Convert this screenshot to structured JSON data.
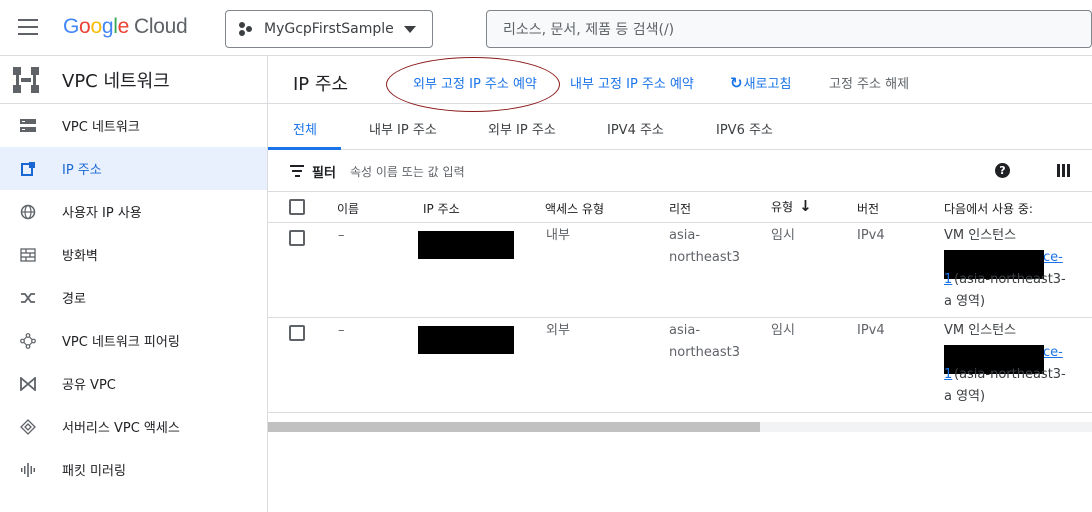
{
  "topbar": {
    "logo": {
      "letters": [
        "G",
        "o",
        "o",
        "g",
        "l",
        "e"
      ],
      "product": "Cloud"
    },
    "project": "MyGcpFirstSample",
    "search_placeholder": "리소스, 문서, 제품 등 검색(/)"
  },
  "sidebar": {
    "title": "VPC 네트워크",
    "items": [
      {
        "label": "VPC 네트워크",
        "icon": "vpc-network-icon",
        "active": false
      },
      {
        "label": "IP 주소",
        "icon": "ip-address-icon",
        "active": true
      },
      {
        "label": "사용자 IP 사용",
        "icon": "globe-icon",
        "active": false
      },
      {
        "label": "방화벽",
        "icon": "firewall-icon",
        "active": false
      },
      {
        "label": "경로",
        "icon": "routes-icon",
        "active": false
      },
      {
        "label": "VPC 네트워크 피어링",
        "icon": "peering-icon",
        "active": false
      },
      {
        "label": "공유 VPC",
        "icon": "shared-vpc-icon",
        "active": false
      },
      {
        "label": "서버리스 VPC 액세스",
        "icon": "serverless-icon",
        "active": false
      },
      {
        "label": "패킷 미러링",
        "icon": "packet-mirroring-icon",
        "active": false
      }
    ]
  },
  "header": {
    "title": "IP 주소",
    "actions": {
      "reserve_external": "외부 고정 IP 주소 예약",
      "reserve_internal": "내부 고정 IP 주소 예약",
      "refresh": "새로고침",
      "release": "고정 주소 해제"
    }
  },
  "tabs": [
    "전체",
    "내부 IP 주소",
    "외부 IP 주소",
    "IPV4 주소",
    "IPV6 주소"
  ],
  "active_tab": "전체",
  "filter": {
    "label": "필터",
    "placeholder": "속성 이름 또는 값 입력"
  },
  "table": {
    "columns": [
      "이름",
      "IP 주소",
      "액세스 유형",
      "리전",
      "유형",
      "버전",
      "다음에서 사용 중:"
    ],
    "rows": [
      {
        "name": "–",
        "access": "내부",
        "region_l1": "asia-",
        "region_l2": "northeast3",
        "type": "임시",
        "version": "IPv4",
        "used_by_l1": "VM 인스턴스",
        "used_by_frag1": "ce-",
        "used_by_frag2": "1",
        "used_by_frag3": "(asia-northeast3-",
        "used_by_l4": "a 영역)"
      },
      {
        "name": "–",
        "access": "외부",
        "region_l1": "asia-",
        "region_l2": "northeast3",
        "type": "임시",
        "version": "IPv4",
        "used_by_l1": "VM 인스턴스",
        "used_by_frag1": "ce-",
        "used_by_frag2": "1",
        "used_by_frag3": "(asia-northeast3-",
        "used_by_l4": "a 영역)"
      }
    ]
  },
  "colors": {
    "accent": "#1a73e8",
    "active_bg": "#e8f0fe",
    "annotation": "#8b1a1a"
  }
}
